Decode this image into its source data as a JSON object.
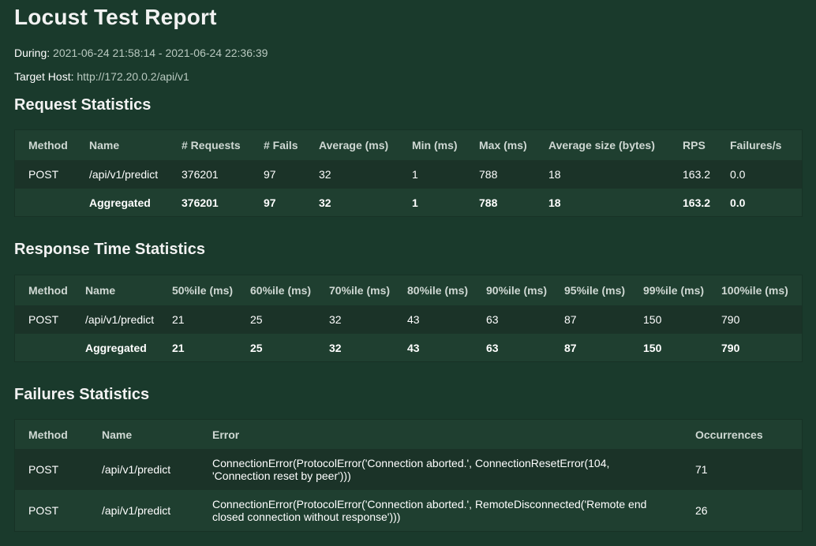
{
  "report": {
    "title": "Locust Test Report",
    "during_label": "During:",
    "during_value": "2021-06-24 21:58:14 - 2021-06-24 22:36:39",
    "host_label": "Target Host:",
    "host_value": "http://172.20.0.2/api/v1"
  },
  "request_stats": {
    "heading": "Request Statistics",
    "headers": [
      "Method",
      "Name",
      "# Requests",
      "# Fails",
      "Average (ms)",
      "Min (ms)",
      "Max (ms)",
      "Average size (bytes)",
      "RPS",
      "Failures/s"
    ],
    "rows": [
      [
        "POST",
        "/api/v1/predict",
        "376201",
        "97",
        "32",
        "1",
        "788",
        "18",
        "163.2",
        "0.0"
      ],
      [
        "",
        "Aggregated",
        "376201",
        "97",
        "32",
        "1",
        "788",
        "18",
        "163.2",
        "0.0"
      ]
    ]
  },
  "response_stats": {
    "heading": "Response Time Statistics",
    "headers": [
      "Method",
      "Name",
      "50%ile (ms)",
      "60%ile (ms)",
      "70%ile (ms)",
      "80%ile (ms)",
      "90%ile (ms)",
      "95%ile (ms)",
      "99%ile (ms)",
      "100%ile (ms)"
    ],
    "rows": [
      [
        "POST",
        "/api/v1/predict",
        "21",
        "25",
        "32",
        "43",
        "63",
        "87",
        "150",
        "790"
      ],
      [
        "",
        "Aggregated",
        "21",
        "25",
        "32",
        "43",
        "63",
        "87",
        "150",
        "790"
      ]
    ]
  },
  "failure_stats": {
    "heading": "Failures Statistics",
    "headers": [
      "Method",
      "Name",
      "Error",
      "Occurrences"
    ],
    "rows": [
      [
        "POST",
        "/api/v1/predict",
        "ConnectionError(ProtocolError('Connection aborted.', ConnectionResetError(104, 'Connection reset by peer')))",
        "71"
      ],
      [
        "POST",
        "/api/v1/predict",
        "ConnectionError(ProtocolError('Connection aborted.', RemoteDisconnected('Remote end closed connection without response')))",
        "26"
      ]
    ]
  }
}
